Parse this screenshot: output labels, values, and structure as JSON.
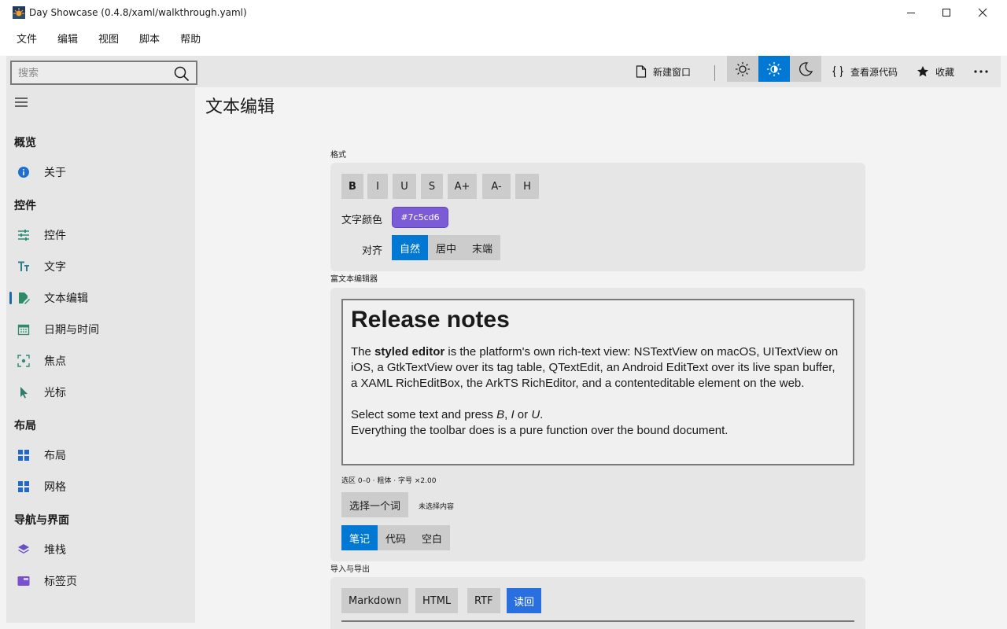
{
  "window": {
    "title": "Day Showcase (0.4.8/xaml/walkthrough.yaml)",
    "controls": [
      "minimize",
      "maximize",
      "close"
    ]
  },
  "menu": [
    "文件",
    "编辑",
    "视图",
    "脚本",
    "帮助"
  ],
  "toolbar": {
    "search_placeholder": "搜索",
    "new_window_label": "新建窗口",
    "view_source_label": "查看源代码",
    "favorite_label": "收藏",
    "theme_selected": "light"
  },
  "sidebar": {
    "sections": [
      {
        "header": "概览",
        "items": [
          {
            "label": "关于",
            "icon": "info-icon"
          }
        ]
      },
      {
        "header": "控件",
        "items": [
          {
            "label": "控件",
            "icon": "sliders-icon"
          },
          {
            "label": "文字",
            "icon": "text-size-icon"
          },
          {
            "label": "文本编辑",
            "icon": "edit-document-icon",
            "selected": true
          },
          {
            "label": "日期与时间",
            "icon": "calendar-icon"
          },
          {
            "label": "焦点",
            "icon": "focus-icon"
          },
          {
            "label": "光标",
            "icon": "cursor-icon"
          }
        ]
      },
      {
        "header": "布局",
        "items": [
          {
            "label": "布局",
            "icon": "layout-icon"
          },
          {
            "label": "网格",
            "icon": "grid-icon"
          }
        ]
      },
      {
        "header": "导航与界面",
        "items": [
          {
            "label": "堆栈",
            "icon": "stack-icon"
          },
          {
            "label": "标签页",
            "icon": "tabs-icon"
          }
        ]
      }
    ]
  },
  "main": {
    "title": "文本编辑",
    "format_section": {
      "label": "格式",
      "buttons": [
        "B",
        "I",
        "U",
        "S",
        "A+",
        "A-",
        "H"
      ],
      "color_label": "文字颜色",
      "color_value": "#7c5cd6",
      "align_label": "对齐",
      "align_options": [
        "自然",
        "居中",
        "末端"
      ],
      "align_selected": "自然"
    },
    "rich_section": {
      "label": "富文本编辑器",
      "editor": {
        "heading": "Release notes",
        "para1_pre": "The ",
        "para1_bold": "styled editor",
        "para1_post": " is the platform's own rich-text view: NSTextView on macOS, UITextView on iOS, a GtkTextView over its tag table, QTextEdit, an Android EditText over its live span buffer, a XAML RichEditBox, the ArkTS RichEditor, and a contenteditable element on the web.",
        "para2_pre": "Select some text and press ",
        "para2_b": "B",
        "para2_sep1": ", ",
        "para2_i": "I",
        "para2_sep2": " or ",
        "para2_u": "U",
        "para2_end": ".",
        "para3": "Everything the toolbar does is a pure function over the bound document."
      },
      "selection_info": "选区 0–0 · 粗体 · 字号 ×2.00",
      "select_word_label": "选择一个词",
      "no_selection_label": "未选择内容",
      "presets": [
        "笔记",
        "代码",
        "空白"
      ],
      "preset_selected": "笔记"
    },
    "io_section": {
      "label": "导入与导出",
      "buttons": [
        "Markdown",
        "HTML",
        "RTF",
        "读回"
      ],
      "active": "读回"
    }
  },
  "colors": {
    "accent": "#0078d4",
    "sidebar_bg": "#e6e6e6",
    "card_bg": "#e6e6e6",
    "button_bg": "#cccccc",
    "text_color_chip": "#7c5cd6"
  }
}
